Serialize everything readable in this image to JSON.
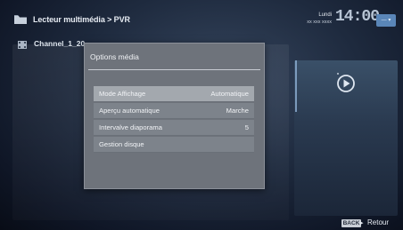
{
  "header": {
    "breadcrumb": "Lecteur multimédia > PVR",
    "date_day": "Lundi",
    "date_full": "xx xxx xxxx",
    "clock": "14:00",
    "status_pill": "— ▾"
  },
  "file_list": {
    "items": [
      {
        "name": "Channel_1_20"
      }
    ]
  },
  "dialog": {
    "title": "Options média",
    "options": [
      {
        "label": "Mode Affichage",
        "value": "Automatique",
        "selected": true
      },
      {
        "label": "Aperçu automatique",
        "value": "Marche",
        "selected": false
      },
      {
        "label": "Intervalve diaporama",
        "value": "5",
        "selected": false
      },
      {
        "label": "Gestion disque",
        "value": "",
        "selected": false
      }
    ]
  },
  "footer": {
    "back_key": "BACK",
    "back_arrow": "▸",
    "back_label": "Retour"
  },
  "colors": {
    "accent": "#5a86b8",
    "dialog_bg": "#6e737b",
    "option_selected": "#a3a8ae"
  },
  "icons": {
    "folder": "folder-icon",
    "file": "video-file-icon",
    "preview": "play-icon"
  }
}
